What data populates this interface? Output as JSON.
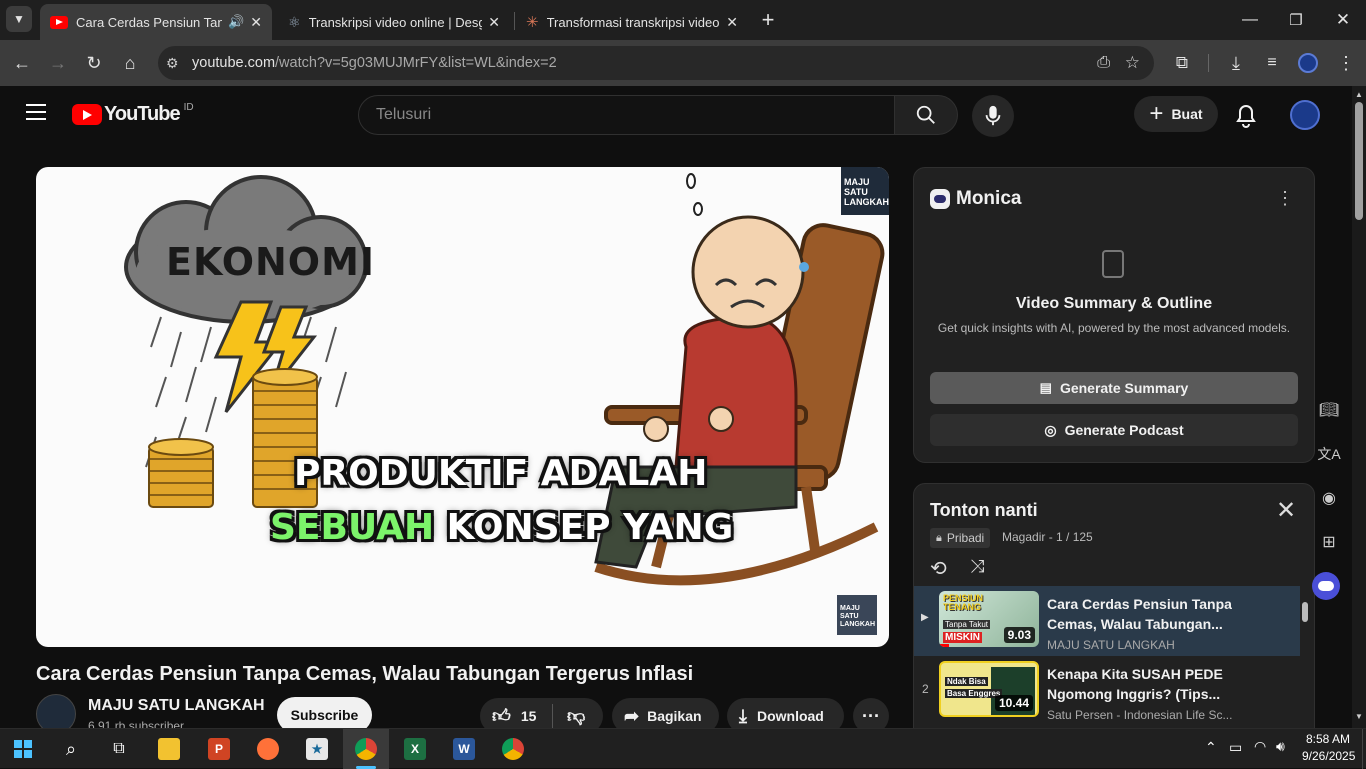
{
  "browser": {
    "tabs": [
      {
        "title": "Cara Cerdas Pensiun Tanpa Cemas",
        "active": true
      },
      {
        "title": "Transkripsi video online | Desgn",
        "active": false
      },
      {
        "title": "Transformasi transkripsi video m",
        "active": false
      }
    ],
    "new_tab_label": "+",
    "url_host": "youtube.com",
    "url_path": "/watch?v=5g03MUJMrFY&list=WL&index=2"
  },
  "youtube": {
    "logo_text": "YouTube",
    "region": "ID",
    "search_placeholder": "Telusuri",
    "create_label": "Buat",
    "video": {
      "title": "Cara Cerdas Pensiun Tanpa Cemas, Walau Tabungan Tergerus Inflasi",
      "cloud_text": "EKONOMI",
      "caption_line1": "PRODUKTIF ADALAH",
      "caption_line2a": "SEBUAH",
      "caption_line2b": "KONSEP YANG",
      "watermark": "MAJU SATU LANGKAH"
    },
    "channel": {
      "name": "MAJU SATU LANGKAH",
      "subscribers": "6,91 rb subscriber",
      "subscribe_label": "Subscribe"
    },
    "actions": {
      "likes": "15",
      "share": "Bagikan",
      "download": "Download",
      "more": "···"
    }
  },
  "monica": {
    "brand": "Monica",
    "heading": "Video Summary & Outline",
    "subtitle": "Get quick insights with AI, powered by the most advanced models.",
    "summary_btn": "Generate Summary",
    "podcast_btn": "Generate Podcast"
  },
  "playlist": {
    "title": "Tonton nanti",
    "privacy": "Pribadi",
    "meta": "Magadir - 1 / 125",
    "items": [
      {
        "index": "▶",
        "title": "Cara Cerdas Pensiun Tanpa Cemas, Walau Tabungan...",
        "channel": "MAJU SATU LANGKAH",
        "duration": "9.03",
        "thumb_top": "PENSIUN TENANG",
        "thumb_mid": "Tanpa Takut",
        "thumb_bot": "MISKIN"
      },
      {
        "index": "2",
        "title": "Kenapa Kita SUSAH PEDE Ngomong Inggris? (Tips...",
        "channel": "Satu Persen - Indonesian Life Sc...",
        "duration": "10.44",
        "thumb_top": "Ndak Bisa",
        "thumb_mid": "Basa Enggres"
      }
    ]
  },
  "taskbar": {
    "time": "8:58 AM",
    "date": "9/26/2025"
  }
}
